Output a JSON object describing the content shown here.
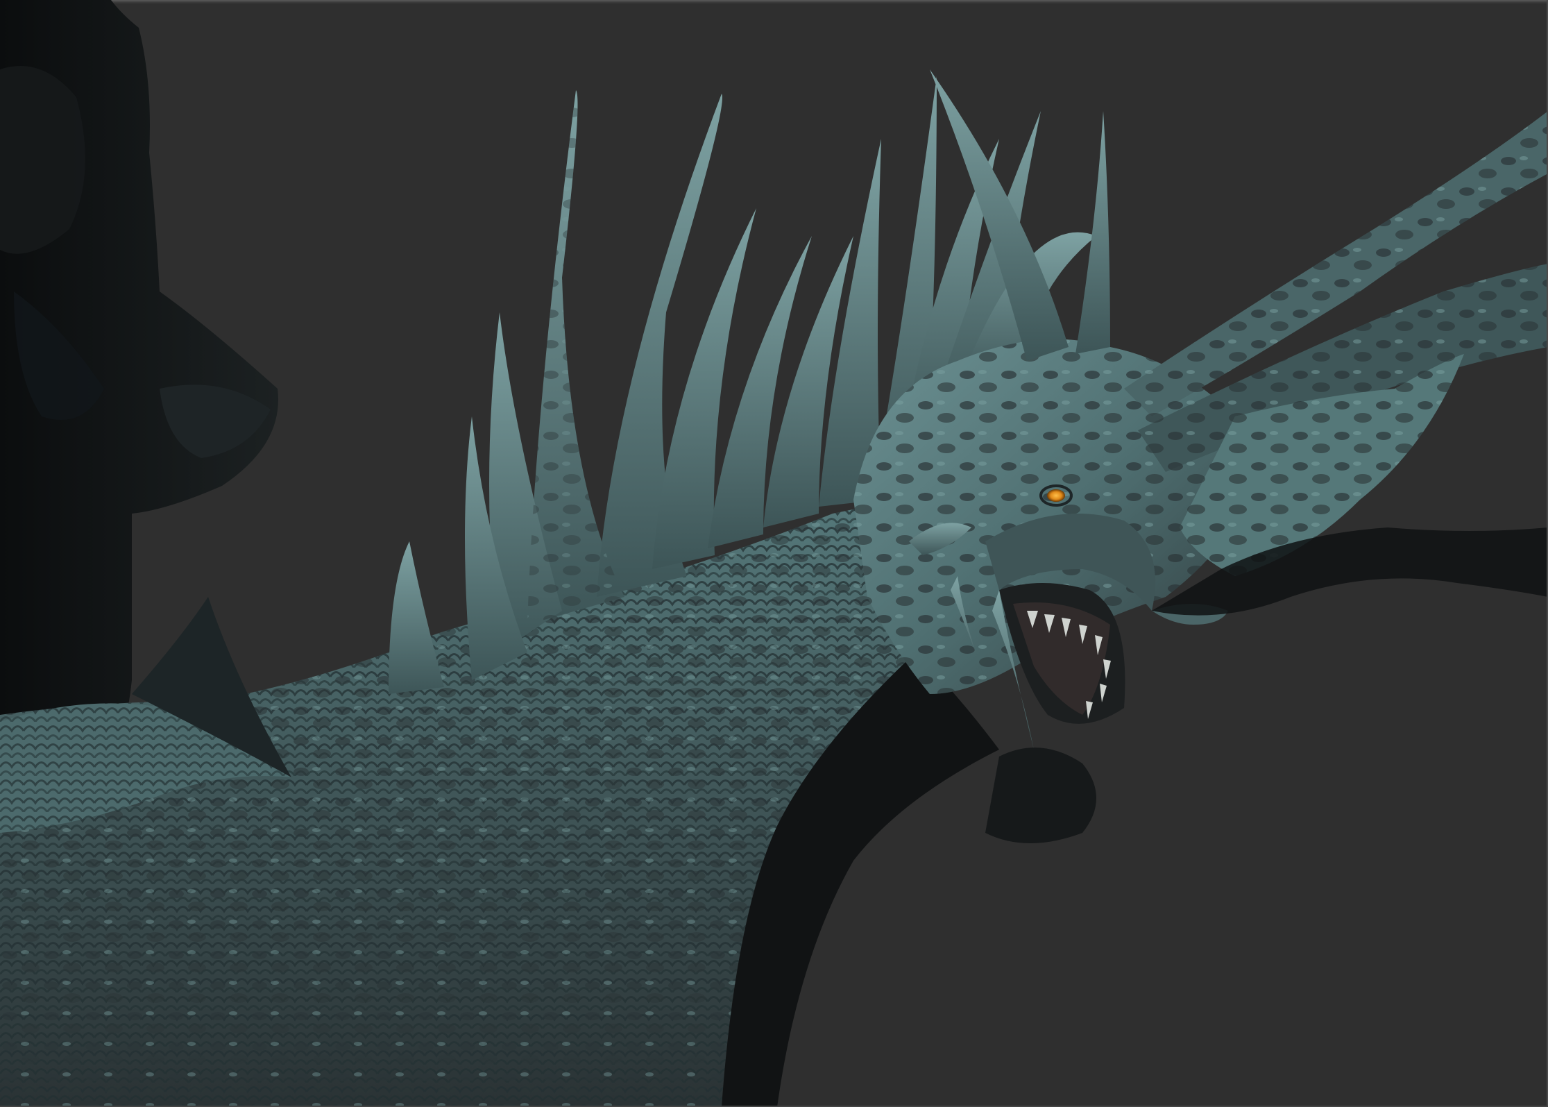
{
  "viewport": {
    "background_color": "#2f2f2f",
    "frame_color": "#4a4a4a",
    "model": {
      "subject": "dragon-sculpt",
      "material_light": "#5f8486",
      "material_dark": "#2d3436",
      "eye_color": "#e08a1a"
    }
  }
}
